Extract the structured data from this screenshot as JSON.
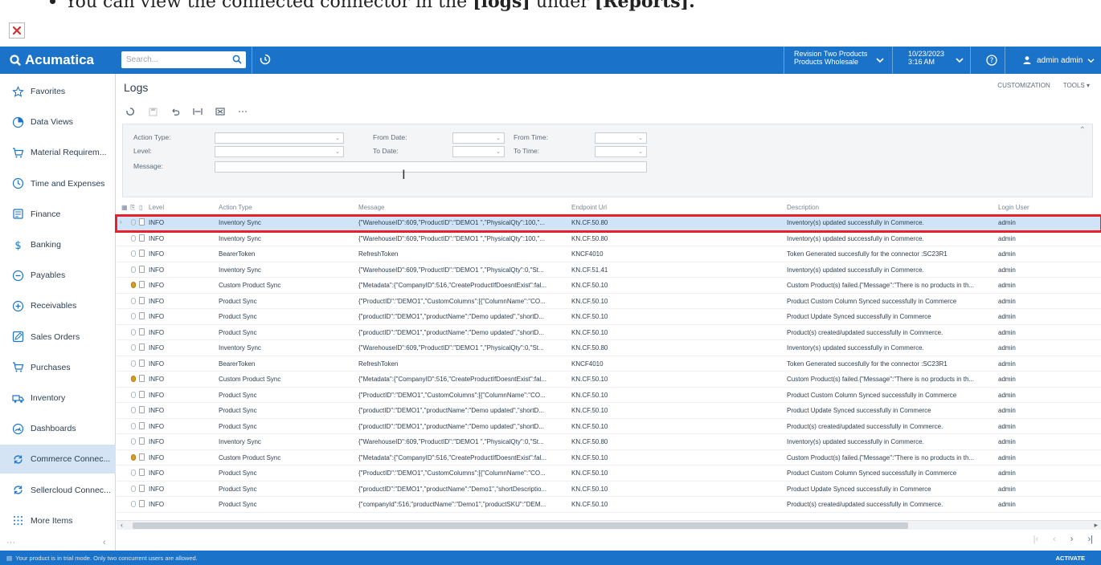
{
  "document": {
    "line_prefix": "You can view the connected connector in the ",
    "line_bold1": "[logs]",
    "line_mid": " under ",
    "line_bold2": "[Reports]."
  },
  "topbar": {
    "logo": "Acumatica",
    "search_placeholder": "Search...",
    "company_line1": "Revision Two Products",
    "company_line2": "Products Wholesale",
    "date_line1": "10/23/2023",
    "date_line2": "3:16 AM",
    "user": "admin admin",
    "color": "#1a73c8"
  },
  "sidebar": {
    "items": [
      {
        "label": "Favorites",
        "icon": "star-icon"
      },
      {
        "label": "Data Views",
        "icon": "data-views-icon"
      },
      {
        "label": "Material Requirem...",
        "icon": "cart-icon"
      },
      {
        "label": "Time and Expenses",
        "icon": "clock-icon"
      },
      {
        "label": "Finance",
        "icon": "finance-icon"
      },
      {
        "label": "Banking",
        "icon": "dollar-icon"
      },
      {
        "label": "Payables",
        "icon": "minus-circle-icon"
      },
      {
        "label": "Receivables",
        "icon": "plus-circle-icon"
      },
      {
        "label": "Sales Orders",
        "icon": "pencil-icon"
      },
      {
        "label": "Purchases",
        "icon": "cart-icon"
      },
      {
        "label": "Inventory",
        "icon": "truck-icon"
      },
      {
        "label": "Dashboards",
        "icon": "gauge-icon"
      },
      {
        "label": "Commerce Connec...",
        "icon": "sync-icon"
      },
      {
        "label": "Sellercloud Connec...",
        "icon": "sync-icon"
      },
      {
        "label": "More Items",
        "icon": "grid-icon"
      }
    ],
    "active_index": 12
  },
  "page": {
    "title": "Logs",
    "customization": "CUSTOMIZATION",
    "tools": "TOOLS ▾"
  },
  "filters": {
    "action_type_label": "Action Type:",
    "level_label": "Level:",
    "message_label": "Message:",
    "from_date_label": "From Date:",
    "to_date_label": "To Date:",
    "from_time_label": "From Time:",
    "to_time_label": "To Time:"
  },
  "grid": {
    "columns": [
      "Level",
      "Action Type",
      "Message",
      "Endpoint Url",
      "Description",
      "Login User"
    ],
    "rows": [
      {
        "level": "INFO",
        "action": "Inventory Sync",
        "message": "{\"WarehouseID\":609,\"ProductID\":\"DEMO1 \",\"PhysicalQty\":100,\"...",
        "endpoint": "KN.CF.50.80",
        "description": "Inventory(s) updated successfully in Commerce.",
        "user": "admin",
        "attn": false
      },
      {
        "level": "INFO",
        "action": "Inventory Sync",
        "message": "{\"WarehouseID\":609,\"ProductID\":\"DEMO1 \",\"PhysicalQty\":100,\"...",
        "endpoint": "KN.CF.50.80",
        "description": "Inventory(s) updated successfully in Commerce.",
        "user": "admin",
        "attn": false
      },
      {
        "level": "INFO",
        "action": "BearerToken",
        "message": "RefreshToken",
        "endpoint": "KNCF4010",
        "description": "Token Generated succesfully for the connector :SC23R1",
        "user": "admin",
        "attn": false
      },
      {
        "level": "INFO",
        "action": "Inventory Sync",
        "message": "{\"WarehouseID\":609,\"ProductID\":\"DEMO1 \",\"PhysicalQty\":0,\"St...",
        "endpoint": "KN.CF.51.41",
        "description": "Inventory(s) updated successfully in Commerce.",
        "user": "admin",
        "attn": false
      },
      {
        "level": "INFO",
        "action": "Custom Product Sync",
        "message": "{\"Metadata\":{\"CompanyID\":516,\"CreateProductIfDoesntExist\":fal...",
        "endpoint": "KN.CF.50.10",
        "description": "Custom Product(s) failed.{\"Message\":\"There is no products in th...",
        "user": "admin",
        "attn": true
      },
      {
        "level": "INFO",
        "action": "Product Sync",
        "message": "{\"ProductID\":\"DEMO1\",\"CustomColumns\":[{\"ColumnName\":\"CO...",
        "endpoint": "KN.CF.50.10",
        "description": "Product Custom Column Synced successfully in Commerce",
        "user": "admin",
        "attn": false
      },
      {
        "level": "INFO",
        "action": "Product Sync",
        "message": "{\"productID\":\"DEMO1\",\"productName\":\"Demo updated\",\"shortD...",
        "endpoint": "KN.CF.50.10",
        "description": "Product Update Synced successfully in Commerce",
        "user": "admin",
        "attn": false
      },
      {
        "level": "INFO",
        "action": "Product Sync",
        "message": "{\"productID\":\"DEMO1\",\"productName\":\"Demo updated\",\"shortD...",
        "endpoint": "KN.CF.50.10",
        "description": "Product(s) created/updated successfully in Commerce.",
        "user": "admin",
        "attn": false
      },
      {
        "level": "INFO",
        "action": "Inventory Sync",
        "message": "{\"WarehouseID\":609,\"ProductID\":\"DEMO1 \",\"PhysicalQty\":0,\"St...",
        "endpoint": "KN.CF.50.80",
        "description": "Inventory(s) updated successfully in Commerce.",
        "user": "admin",
        "attn": false
      },
      {
        "level": "INFO",
        "action": "BearerToken",
        "message": "RefreshToken",
        "endpoint": "KNCF4010",
        "description": "Token Generated succesfully for the connector :SC23R1",
        "user": "admin",
        "attn": false
      },
      {
        "level": "INFO",
        "action": "Custom Product Sync",
        "message": "{\"Metadata\":{\"CompanyID\":516,\"CreateProductIfDoesntExist\":fal...",
        "endpoint": "KN.CF.50.10",
        "description": "Custom Product(s) failed.{\"Message\":\"There is no products in th...",
        "user": "admin",
        "attn": true
      },
      {
        "level": "INFO",
        "action": "Product Sync",
        "message": "{\"ProductID\":\"DEMO1\",\"CustomColumns\":[{\"ColumnName\":\"CO...",
        "endpoint": "KN.CF.50.10",
        "description": "Product Custom Column Synced successfully in Commerce",
        "user": "admin",
        "attn": false
      },
      {
        "level": "INFO",
        "action": "Product Sync",
        "message": "{\"productID\":\"DEMO1\",\"productName\":\"Demo updated\",\"shortD...",
        "endpoint": "KN.CF.50.10",
        "description": "Product Update Synced successfully in Commerce",
        "user": "admin",
        "attn": false
      },
      {
        "level": "INFO",
        "action": "Product Sync",
        "message": "{\"productID\":\"DEMO1\",\"productName\":\"Demo updated\",\"shortD...",
        "endpoint": "KN.CF.50.10",
        "description": "Product(s) created/updated successfully in Commerce.",
        "user": "admin",
        "attn": false
      },
      {
        "level": "INFO",
        "action": "Inventory Sync",
        "message": "{\"WarehouseID\":609,\"ProductID\":\"DEMO1 \",\"PhysicalQty\":0,\"St...",
        "endpoint": "KN.CF.50.80",
        "description": "Inventory(s) updated successfully in Commerce.",
        "user": "admin",
        "attn": false
      },
      {
        "level": "INFO",
        "action": "Custom Product Sync",
        "message": "{\"Metadata\":{\"CompanyID\":516,\"CreateProductIfDoesntExist\":fal...",
        "endpoint": "KN.CF.50.10",
        "description": "Custom Product(s) failed.{\"Message\":\"There is no products in th...",
        "user": "admin",
        "attn": true
      },
      {
        "level": "INFO",
        "action": "Product Sync",
        "message": "{\"ProductID\":\"DEMO1\",\"CustomColumns\":[{\"ColumnName\":\"CO...",
        "endpoint": "KN.CF.50.10",
        "description": "Product Custom Column Synced successfully in Commerce",
        "user": "admin",
        "attn": false
      },
      {
        "level": "INFO",
        "action": "Product Sync",
        "message": "{\"productID\":\"DEMO1\",\"productName\":\"Demo1\",\"shortDescriptio...",
        "endpoint": "KN.CF.50.10",
        "description": "Product Update Synced successfully in Commerce",
        "user": "admin",
        "attn": false
      },
      {
        "level": "INFO",
        "action": "Product Sync",
        "message": "{\"companyId\":516,\"productName\":\"Demo1\",\"productSKU\":\"DEM...",
        "endpoint": "KN.CF.50.10",
        "description": "Product(s) created/updated successfully in Commerce.",
        "user": "admin",
        "attn": false
      }
    ],
    "selected_index": 0
  },
  "status": {
    "message": "Your product is in trial mode. Only two concurrent users are allowed.",
    "activate": "ACTIVATE"
  }
}
